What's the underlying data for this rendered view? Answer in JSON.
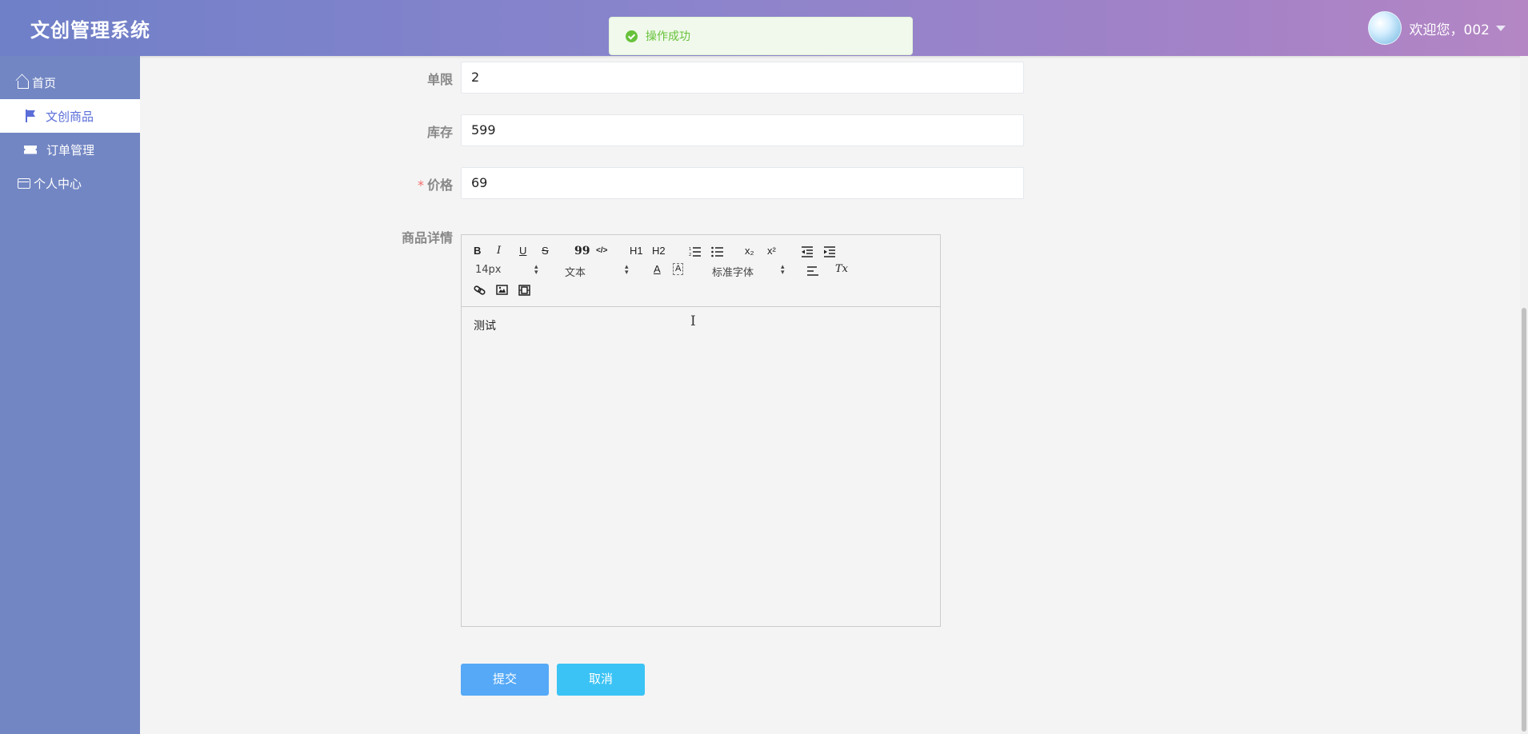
{
  "header": {
    "app_title": "文创管理系统",
    "welcome_text": "欢迎您，002"
  },
  "toast": {
    "message": "操作成功",
    "color": "#67c23a"
  },
  "sidebar": {
    "items": [
      {
        "label": "首页",
        "icon": "home-icon"
      },
      {
        "label": "文创商品",
        "icon": "flag-icon",
        "active": true
      },
      {
        "label": "订单管理",
        "icon": "ticket-icon"
      },
      {
        "label": "个人中心",
        "icon": "card-icon"
      }
    ]
  },
  "form": {
    "limit": {
      "label": "单限",
      "value": "2"
    },
    "stock": {
      "label": "库存",
      "value": "599"
    },
    "price": {
      "label": "价格",
      "required_mark": "*",
      "value": "69"
    },
    "details": {
      "label": "商品详情"
    }
  },
  "editor": {
    "toolbar": {
      "bold": "B",
      "italic": "I",
      "underline": "U",
      "strike": "S",
      "quote": "99",
      "code": "</>",
      "h1": "H1",
      "h2": "H2",
      "ordered_list": "ordered-list-icon",
      "bullet_list": "bullet-list-icon",
      "subscript": "x₂",
      "superscript": "x²",
      "outdent": "outdent-icon",
      "indent": "indent-icon",
      "size_value": "14px",
      "header_value": "文本",
      "text_color": "A",
      "background": "A",
      "font_value": "标准字体",
      "align": "align-icon",
      "clean": "Tx",
      "link": "link-icon",
      "image": "image-icon",
      "video": "video-icon"
    },
    "content": "测试"
  },
  "buttons": {
    "submit": "提交",
    "cancel": "取消"
  }
}
